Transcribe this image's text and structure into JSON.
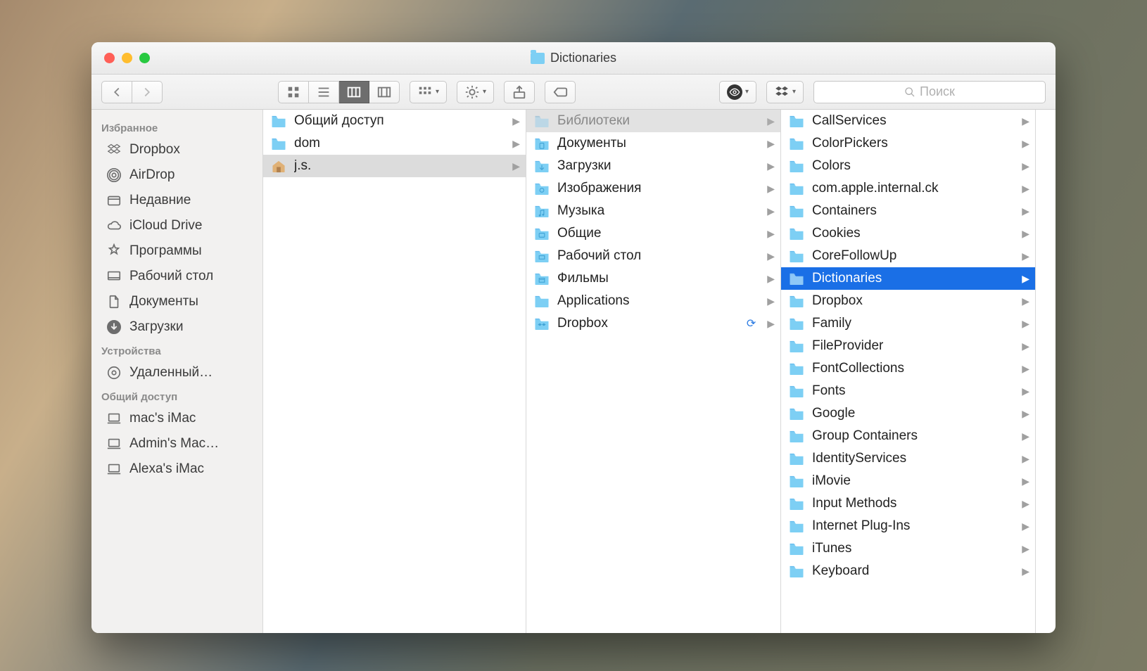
{
  "window": {
    "title": "Dictionaries"
  },
  "toolbar": {
    "search_placeholder": "Поиск"
  },
  "sidebar": {
    "sections": [
      {
        "header": "Избранное",
        "items": [
          {
            "icon": "dropbox",
            "label": "Dropbox"
          },
          {
            "icon": "airdrop",
            "label": "AirDrop"
          },
          {
            "icon": "recents",
            "label": "Недавние"
          },
          {
            "icon": "icloud",
            "label": "iCloud Drive"
          },
          {
            "icon": "apps",
            "label": "Программы"
          },
          {
            "icon": "desktop",
            "label": "Рабочий стол"
          },
          {
            "icon": "documents",
            "label": "Документы"
          },
          {
            "icon": "downloads",
            "label": "Загрузки"
          }
        ]
      },
      {
        "header": "Устройства",
        "items": [
          {
            "icon": "disc",
            "label": "Удаленный…"
          }
        ]
      },
      {
        "header": "Общий доступ",
        "items": [
          {
            "icon": "computer",
            "label": " mac's iMac"
          },
          {
            "icon": "computer",
            "label": "Admin's Mac…"
          },
          {
            "icon": "computer",
            "label": "Alexa's iMac"
          }
        ]
      }
    ]
  },
  "columns": [
    [
      {
        "name": "Общий доступ",
        "icon": "folder",
        "arrow": true
      },
      {
        "name": "dom",
        "icon": "folder",
        "arrow": true
      },
      {
        "name": "j.s.",
        "icon": "home",
        "arrow": true,
        "state": "gray"
      }
    ],
    [
      {
        "name": "Библиотеки",
        "icon": "library",
        "arrow": true,
        "state": "dim"
      },
      {
        "name": "Документы",
        "icon": "folder-doc",
        "arrow": true
      },
      {
        "name": "Загрузки",
        "icon": "folder-dl",
        "arrow": true
      },
      {
        "name": "Изображения",
        "icon": "folder-img",
        "arrow": true
      },
      {
        "name": "Музыка",
        "icon": "folder-music",
        "arrow": true
      },
      {
        "name": "Общие",
        "icon": "folder-public",
        "arrow": true
      },
      {
        "name": "Рабочий стол",
        "icon": "folder-desk",
        "arrow": true
      },
      {
        "name": "Фильмы",
        "icon": "folder-movie",
        "arrow": true
      },
      {
        "name": "Applications",
        "icon": "folder",
        "arrow": true
      },
      {
        "name": "Dropbox",
        "icon": "folder-dropbox",
        "arrow": true,
        "sync": true
      }
    ],
    [
      {
        "name": "CallServices",
        "icon": "folder",
        "arrow": true
      },
      {
        "name": "ColorPickers",
        "icon": "folder",
        "arrow": true
      },
      {
        "name": "Colors",
        "icon": "folder",
        "arrow": true
      },
      {
        "name": "com.apple.internal.ck",
        "icon": "folder",
        "arrow": true
      },
      {
        "name": "Containers",
        "icon": "folder",
        "arrow": true
      },
      {
        "name": "Cookies",
        "icon": "folder",
        "arrow": true
      },
      {
        "name": "CoreFollowUp",
        "icon": "folder",
        "arrow": true
      },
      {
        "name": "Dictionaries",
        "icon": "folder",
        "arrow": true,
        "state": "blue"
      },
      {
        "name": "Dropbox",
        "icon": "folder",
        "arrow": true
      },
      {
        "name": "Family",
        "icon": "folder",
        "arrow": true
      },
      {
        "name": "FileProvider",
        "icon": "folder",
        "arrow": true
      },
      {
        "name": "FontCollections",
        "icon": "folder",
        "arrow": true
      },
      {
        "name": "Fonts",
        "icon": "folder",
        "arrow": true
      },
      {
        "name": "Google",
        "icon": "folder",
        "arrow": true
      },
      {
        "name": "Group Containers",
        "icon": "folder",
        "arrow": true
      },
      {
        "name": "IdentityServices",
        "icon": "folder",
        "arrow": true
      },
      {
        "name": "iMovie",
        "icon": "folder",
        "arrow": true
      },
      {
        "name": "Input Methods",
        "icon": "folder",
        "arrow": true
      },
      {
        "name": "Internet Plug-Ins",
        "icon": "folder",
        "arrow": true
      },
      {
        "name": "iTunes",
        "icon": "folder",
        "arrow": true
      },
      {
        "name": "Keyboard",
        "icon": "folder",
        "arrow": true
      }
    ]
  ]
}
